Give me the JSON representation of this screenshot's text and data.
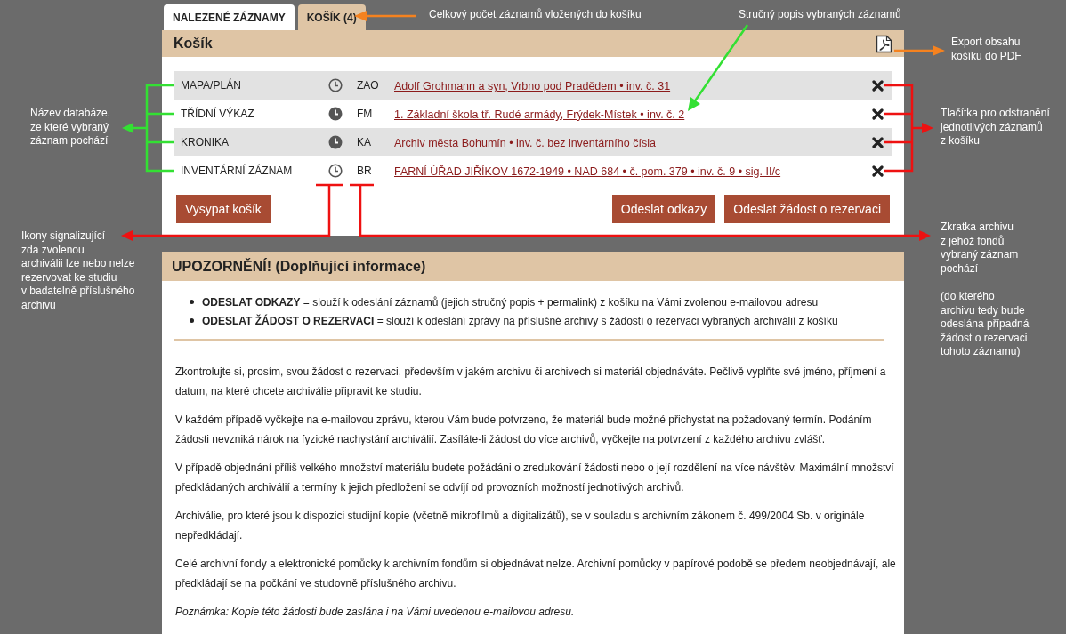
{
  "tabs": [
    {
      "label": "NALEZENÉ ZÁZNAMY",
      "selected": false
    },
    {
      "label": "KOŠÍK (4)",
      "selected": true
    }
  ],
  "basket": {
    "title": "Košík",
    "rows": [
      {
        "database": "MAPA/PLÁN",
        "filled_clock": false,
        "archive": "ZAO",
        "record": "Adolf Grohmann a syn, Vrbno pod Pradědem • inv. č. 31"
      },
      {
        "database": "TŘÍDNÍ VÝKAZ",
        "filled_clock": true,
        "archive": "FM",
        "record": "1. Základní škola tř. Rudé armády, Frýdek-Místek • inv. č. 2"
      },
      {
        "database": "KRONIKA",
        "filled_clock": true,
        "archive": "KA",
        "record": "Archiv města Bohumín • inv. č. bez inventárního čísla"
      },
      {
        "database": "INVENTÁRNÍ ZÁZNAM",
        "filled_clock": false,
        "archive": "BR",
        "record": "FARNÍ ÚŘAD JIŘÍKOV 1672-1949 • NAD 684 • č. pom. 379 • inv. č. 9 • sig. II/c"
      }
    ],
    "empty_button": "Vysypat košík",
    "send_buttons": [
      "Odeslat odkazy",
      "Odeslat žádost o rezervaci"
    ]
  },
  "notice": {
    "title": "UPOZORNĚNÍ! (Doplňující informace)",
    "bullets": [
      "**ODESLAT ODKAZY** = slouží k odeslání záznamů (jejich stručný popis + permalink) z košíku na Vámi zvolenou e-mailovou adresu",
      "**ODESLAT ŽÁDOST O REZERVACI** = slouží k odeslání zprávy na příslušné archivy s žádostí o rezervaci vybraných archiválií z košíku"
    ],
    "paragraphs": [
      "Zkontrolujte si, prosím, svou žádost o rezervaci, především v jakém archivu či archivech si materiál objednáváte. Pečlivě vyplňte své jméno, příjmení a datum, na které chcete archiválie připravit ke studiu.",
      "V každém případě vyčkejte na e-mailovou zprávu, kterou Vám bude potvrzeno, že materiál bude možné přichystat na požadovaný termín. Podáním žádosti nevzniká nárok na fyzické nachystání archiválií. Zasíláte-li žádost do více archivů, vyčkejte na potvrzení z každého archivu zvlášť.",
      "V případě objednání příliš velkého množství materiálu budete požádáni o zredukování žádosti nebo o její rozdělení na více návštěv. Maximální množství předkládaných archiválií a termíny k jejich předložení se odvíjí od provozních možností jednotlivých archivů.",
      "Archiválie, pro které jsou k dispozici studijní kopie (včetně mikrofilmů a digitalizátů), se v souladu s archivním zákonem č. 499/2004 Sb. v originále nepředkládají.",
      "Celé archivní fondy a elektronické pomůcky k archivním fondům si objednávat nelze. Archivní pomůcky v papírové podobě se předem neobjednávají, ale předkládají se na počkání ve studovně příslušného archivu."
    ],
    "note": "Poznámka: Kopie této žádosti bude zaslána i na Vámi uvedenou e-mailovou adresu."
  },
  "annotations": [
    {
      "text": "Celkový počet záznamů vložených do košíku"
    },
    {
      "text": "Stručný popis vybraných záznamů"
    },
    {
      "text": "Export obsahu\nkošíku do PDF"
    },
    {
      "text": "Název databáze,\nze které vybraný\nzáznam pochází"
    },
    {
      "text": "Tlačítka pro odstranění\njednotlivých záznamů\nz košíku"
    },
    {
      "text": "Ikony signalizující\nzda zvolenou\narchiválii lze nebo nelze\nrezervovat ke studiu\nv badatelně příslušného\narchivu"
    },
    {
      "text": "Zkratka archivu\nz jehož fondů\nvybraný záznam\npochází\n\n(do kterého\narchivu tedy bude\nodeslána případná\nžádost o rezervaci\ntohoto záznamu)"
    }
  ]
}
